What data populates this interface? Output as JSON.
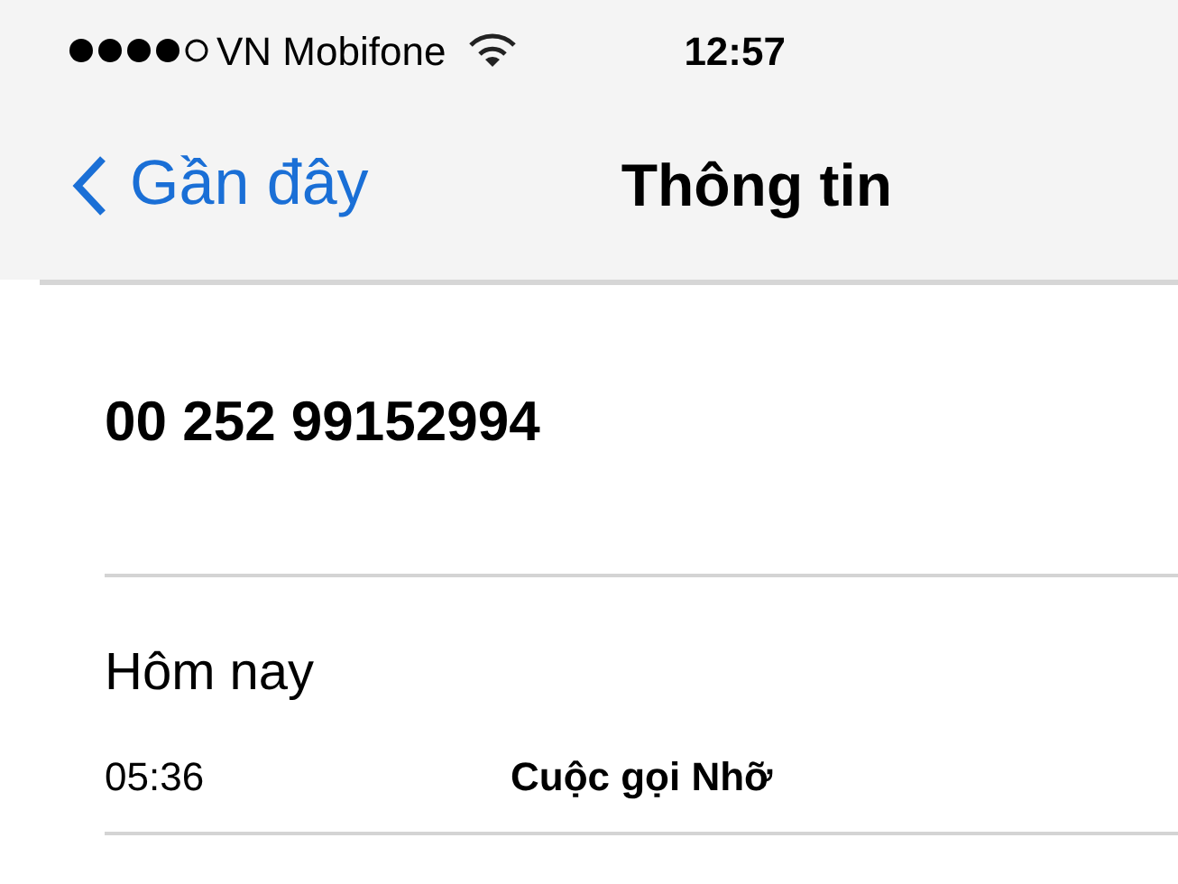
{
  "status_bar": {
    "carrier": "VN Mobifone",
    "time": "12:57"
  },
  "nav_bar": {
    "back": "Gần đây",
    "title": "Thông tin"
  },
  "phone_number": "00 252 99152994",
  "calls": {
    "day": "Hôm nay",
    "entries": [
      {
        "time": "05:36",
        "type": "Cuộc gọi Nhỡ"
      }
    ]
  }
}
